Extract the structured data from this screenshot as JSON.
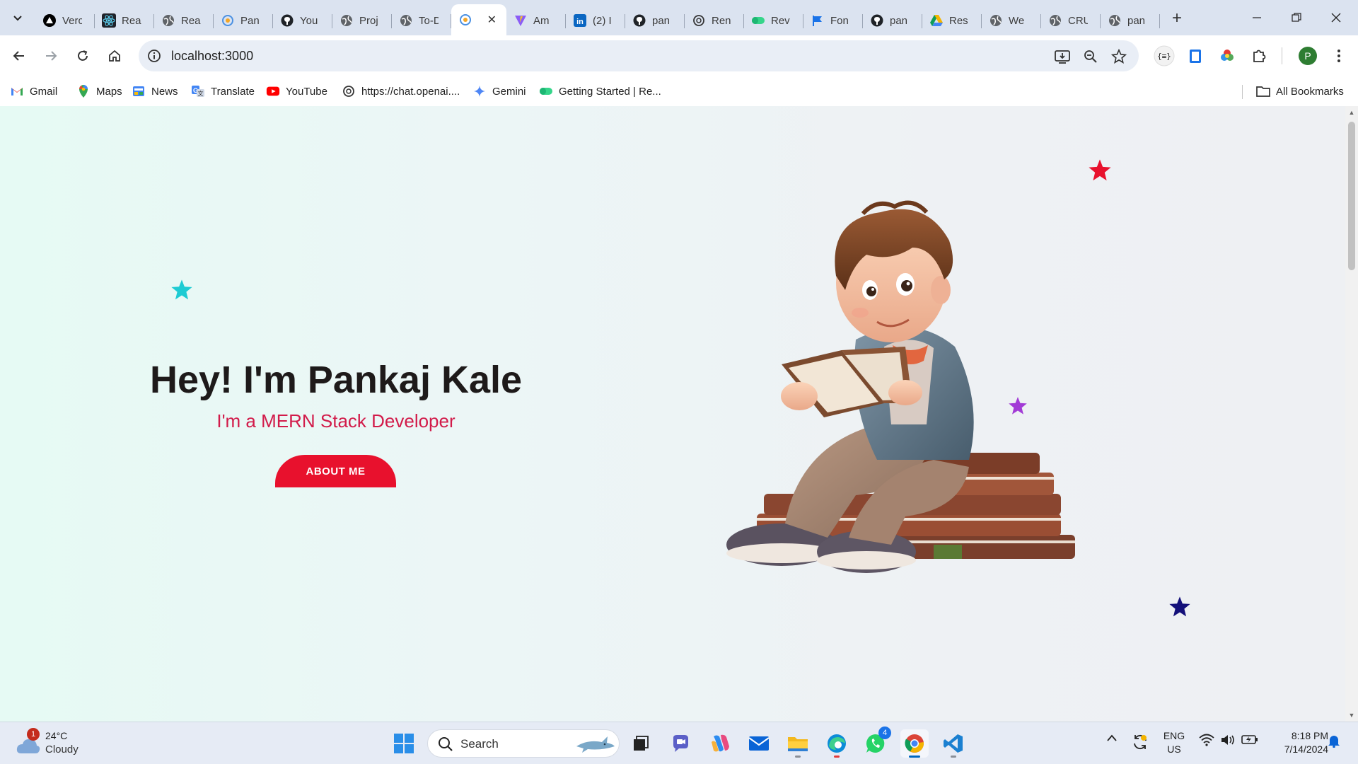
{
  "browser": {
    "tabs": [
      {
        "title": "Verc",
        "icon": "vercel-icon"
      },
      {
        "title": "Rea",
        "icon": "react-icon"
      },
      {
        "title": "Rea",
        "icon": "globe-icon"
      },
      {
        "title": "Pan",
        "icon": "gear-icon"
      },
      {
        "title": "You",
        "icon": "github-icon"
      },
      {
        "title": "Proj",
        "icon": "globe-icon"
      },
      {
        "title": "To-D",
        "icon": "globe-icon"
      },
      {
        "title": "",
        "icon": "gear-icon",
        "active": true
      },
      {
        "title": "Am",
        "icon": "vite-icon"
      },
      {
        "title": "(2) I",
        "icon": "linkedin-icon"
      },
      {
        "title": "pan",
        "icon": "github-icon"
      },
      {
        "title": "Ren",
        "icon": "openai-icon"
      },
      {
        "title": "Rev",
        "icon": "pill-icon"
      },
      {
        "title": "Fon",
        "icon": "flag-icon"
      },
      {
        "title": "pan",
        "icon": "github-icon"
      },
      {
        "title": "Res",
        "icon": "drive-icon"
      },
      {
        "title": "We",
        "icon": "globe-icon"
      },
      {
        "title": "CRU",
        "icon": "globe-icon"
      },
      {
        "title": "pan",
        "icon": "globe-icon"
      }
    ],
    "new_tab_label": "+",
    "url": "localhost:3000",
    "profile_initial": "P"
  },
  "bookmarks": [
    {
      "label": "Gmail",
      "icon": "gmail-icon"
    },
    {
      "label": "Maps",
      "icon": "maps-icon"
    },
    {
      "label": "News",
      "icon": "news-icon"
    },
    {
      "label": "Translate",
      "icon": "translate-icon"
    },
    {
      "label": "YouTube",
      "icon": "youtube-icon"
    },
    {
      "label": "https://chat.openai....",
      "icon": "openai-icon"
    },
    {
      "label": "Gemini",
      "icon": "gemini-icon"
    },
    {
      "label": "Getting Started | Re...",
      "icon": "pill-icon"
    }
  ],
  "all_bookmarks_label": "All Bookmarks",
  "hero": {
    "title": "Hey! I'm Pankaj Kale",
    "subtitle": "I'm a MERN Stack Developer",
    "button_label": "ABOUT ME"
  },
  "colors": {
    "accent_red": "#e8112d",
    "subtitle_pink": "#d21b4a",
    "star_cyan": "#1ecbd3",
    "star_red": "#e8112d",
    "star_purple": "#a23bd6",
    "star_navy": "#14107a"
  },
  "taskbar": {
    "weather_temp": "24°C",
    "weather_condition": "Cloudy",
    "weather_badge": "1",
    "search_placeholder": "Search",
    "whatsapp_badge": "4",
    "lang_line1": "ENG",
    "lang_line2": "US",
    "time": "8:18 PM",
    "date": "7/14/2024"
  }
}
